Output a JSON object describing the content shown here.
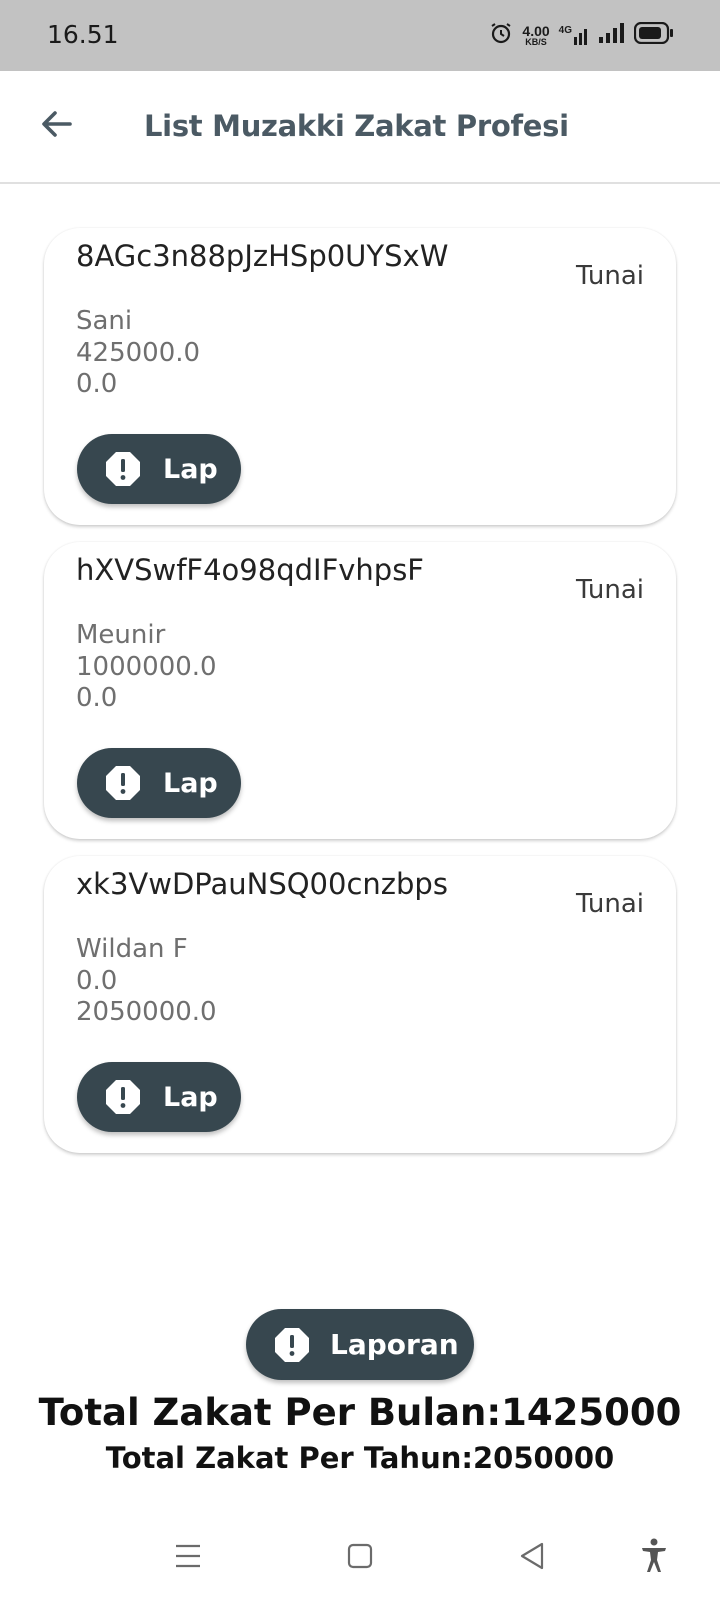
{
  "status_bar": {
    "time": "16.51",
    "net_speed_value": "4.00",
    "net_speed_unit": "KB/S",
    "network_type": "4G",
    "icons": [
      "alarm-icon",
      "network-4g-icon",
      "signal-icon",
      "signal-icon-2",
      "battery-icon"
    ]
  },
  "app_bar": {
    "title": "List Muzakki Zakat Profesi",
    "back_icon": "arrow-left-icon"
  },
  "cards": [
    {
      "id": "8AGc3n88pJzHSp0UYSxW",
      "method": "Tunai",
      "name": "Sani",
      "value1": "425000.0",
      "value2": "0.0",
      "button_label": "Lap",
      "button_icon": "exclamation-octagon-icon"
    },
    {
      "id": "hXVSwfF4o98qdIFvhpsF",
      "method": "Tunai",
      "name": "Meunir",
      "value1": "1000000.0",
      "value2": "0.0",
      "button_label": "Lap",
      "button_icon": "exclamation-octagon-icon"
    },
    {
      "id": "xk3VwDPauNSQ00cnzbps",
      "method": "Tunai",
      "name": "Wildan F",
      "value1": "0.0",
      "value2": "2050000.0",
      "button_label": "Lap",
      "button_icon": "exclamation-octagon-icon"
    }
  ],
  "report_button": {
    "label": "Laporan",
    "icon": "exclamation-octagon-icon"
  },
  "totals": {
    "per_month": "Total Zakat Per Bulan:1425000",
    "per_year": "Total Zakat Per Tahun:2050000"
  },
  "nav_bar": {
    "icons": [
      "menu-icon",
      "home-square-icon",
      "back-triangle-icon",
      "accessibility-icon"
    ]
  },
  "colors": {
    "status_bar_bg": "#c2c2c2",
    "title_color": "#4b5a64",
    "button_bg": "#37474f",
    "button_text": "#ffffff"
  }
}
